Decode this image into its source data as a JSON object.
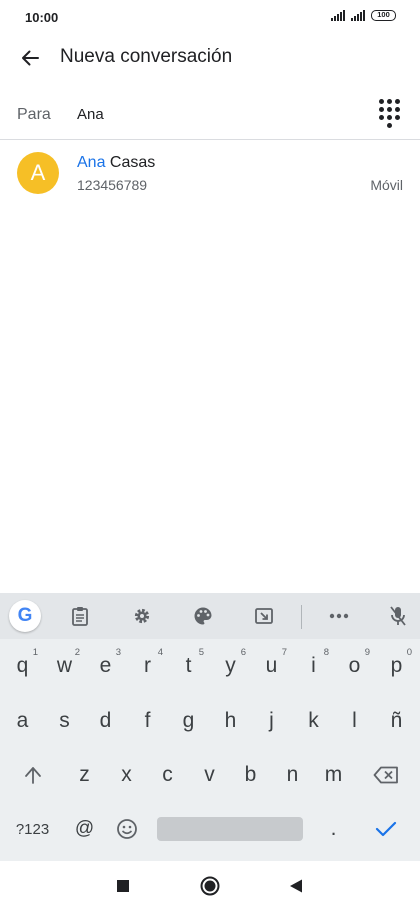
{
  "status_bar": {
    "time": "10:00",
    "battery": "100"
  },
  "app_bar": {
    "title": "Nueva conversación",
    "back_icon": "arrow-back-icon"
  },
  "recipient": {
    "label": "Para",
    "value": "Ana",
    "dialpad_icon": "dialpad-icon"
  },
  "suggestion": {
    "avatar_letter": "A",
    "avatar_color": "#f6bf26",
    "name_match": "Ana",
    "name_rest": " Casas",
    "phone": "123456789",
    "type": "Móvil",
    "highlight_color": "#1a73e8"
  },
  "keyboard": {
    "toolbar_icons": [
      "google-icon",
      "clipboard-icon",
      "settings-gear-icon",
      "palette-icon",
      "resize-keyboard-icon",
      "more-icon",
      "mic-off-icon"
    ],
    "google_letter": "G",
    "row1": [
      {
        "key": "q",
        "hint": "1"
      },
      {
        "key": "w",
        "hint": "2"
      },
      {
        "key": "e",
        "hint": "3"
      },
      {
        "key": "r",
        "hint": "4"
      },
      {
        "key": "t",
        "hint": "5"
      },
      {
        "key": "y",
        "hint": "6"
      },
      {
        "key": "u",
        "hint": "7"
      },
      {
        "key": "i",
        "hint": "8"
      },
      {
        "key": "o",
        "hint": "9"
      },
      {
        "key": "p",
        "hint": "0"
      }
    ],
    "row2": [
      "a",
      "s",
      "d",
      "f",
      "g",
      "h",
      "j",
      "k",
      "l",
      "ñ"
    ],
    "row3": [
      "z",
      "x",
      "c",
      "v",
      "b",
      "n",
      "m"
    ],
    "symbols_label": "?123",
    "at_label": "@",
    "period_label": ".",
    "shift_icon": "shift-arrow-icon",
    "backspace_icon": "backspace-icon",
    "emoji_icon": "emoji-icon",
    "enter_icon": "checkmark-icon",
    "accent_color": "#1a73e8"
  },
  "nav_bar": {
    "recents_icon": "square-recents-icon",
    "home_icon": "circle-home-icon",
    "back_icon": "triangle-back-icon"
  }
}
